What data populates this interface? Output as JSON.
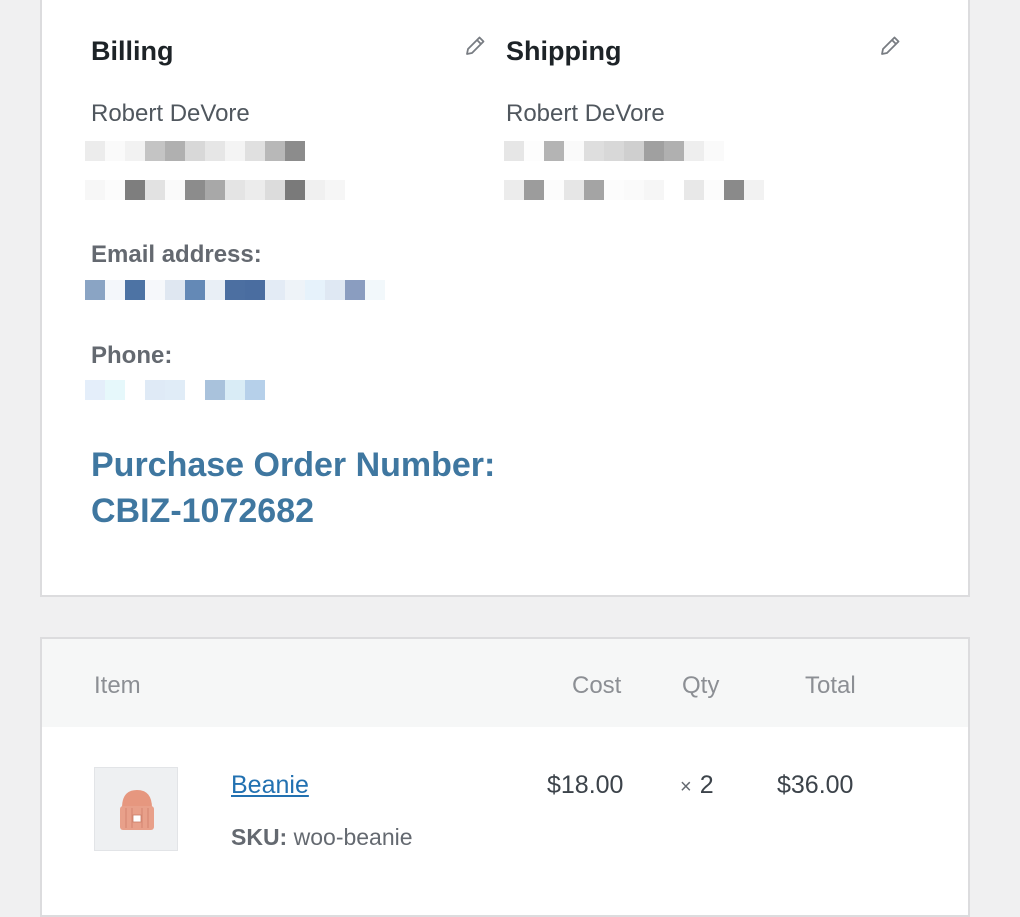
{
  "billing": {
    "title": "Billing",
    "name": "Robert DeVore",
    "email_label": "Email address:",
    "phone_label": "Phone:",
    "purchase_order": "Purchase Order Number: CBIZ-1072682",
    "edit_icon": "pencil-icon"
  },
  "shipping": {
    "title": "Shipping",
    "name": "Robert DeVore",
    "edit_icon": "pencil-icon"
  },
  "items": {
    "headers": {
      "item": "Item",
      "cost": "Cost",
      "qty": "Qty",
      "total": "Total"
    },
    "rows": [
      {
        "name": "Beanie",
        "sku_label": "SKU:",
        "sku": "woo-beanie",
        "cost": "$18.00",
        "qty_symbol": "×",
        "qty": "2",
        "total": "$36.00",
        "thumbnail_icon": "beanie-hat-icon"
      }
    ]
  },
  "colors": {
    "link": "#2271b1",
    "po_text": "#3f77a0",
    "background": "#f0f0f1"
  }
}
